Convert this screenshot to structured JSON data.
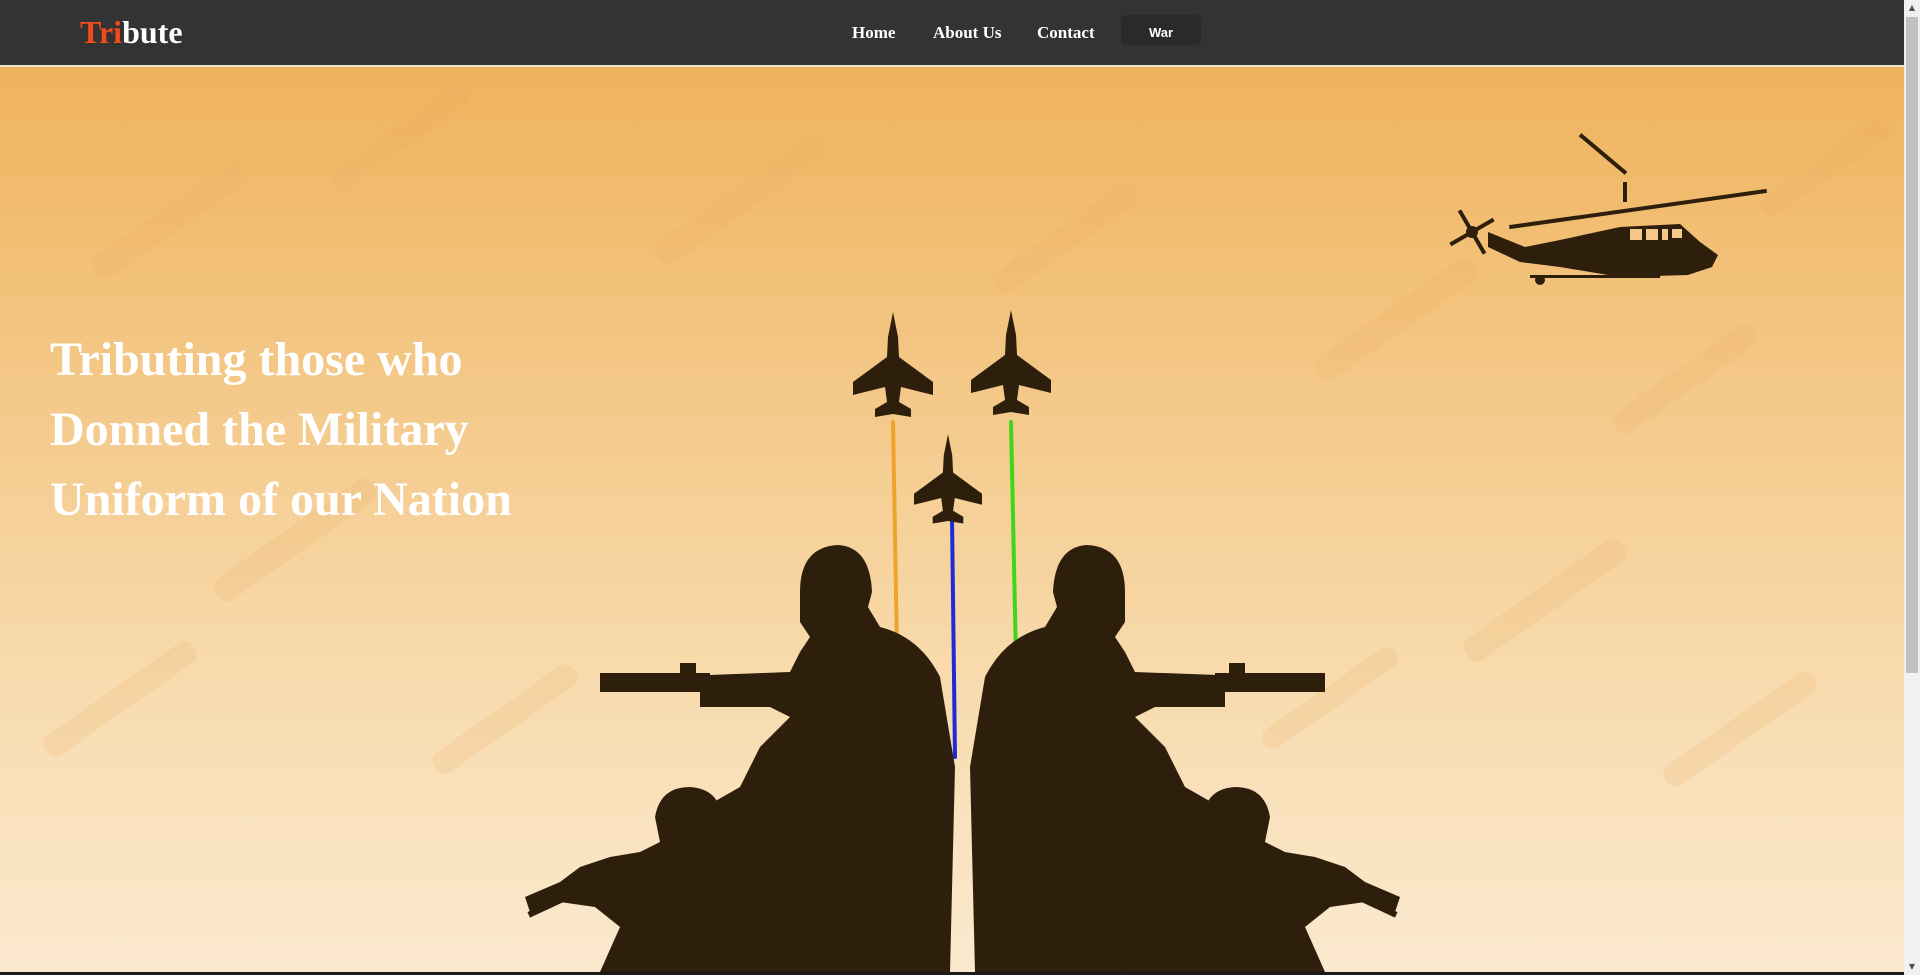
{
  "header": {
    "logo_accent": "Tri",
    "logo_rest": "bute",
    "nav": {
      "home": "Home",
      "about": "About Us",
      "contact": "Contact",
      "war_button": "War"
    }
  },
  "hero": {
    "title_lines": [
      "Tributing those who",
      "Donned the Military",
      "Uniform of our Nation"
    ],
    "illustration": {
      "elements": [
        "helicopter-icon",
        "fighter-jet-icon",
        "fighter-jet-icon",
        "fighter-jet-icon",
        "soldier-silhouette-icon"
      ],
      "trail_colors": [
        "#f0a32a",
        "#1e2bd6",
        "#3fd61a"
      ],
      "silhouette_color": "#2e1f0d"
    }
  },
  "colors": {
    "navbar": "#333333",
    "accent": "#ef4b1b",
    "sky_top": "#efb35c",
    "sky_bottom": "#fbe9cf"
  }
}
